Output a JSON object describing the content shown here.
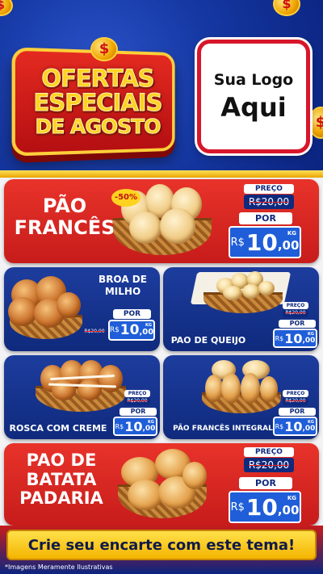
{
  "header": {
    "title_lines": [
      "OFERTAS",
      "ESPECIAIS",
      "DE AGOSTO"
    ],
    "coin_symbol": "$",
    "logo_line1": "Sua Logo",
    "logo_line2": "Aqui"
  },
  "labels": {
    "preco": "PREÇO",
    "por": "POR",
    "currency": "R$",
    "unit": "KG"
  },
  "products": {
    "pao_frances": {
      "name_line1": "PÃO",
      "name_line2": "FRANCÊS",
      "discount": "-50%",
      "old_price": "R$20,00",
      "price_int": "10",
      "price_dec": ",00"
    },
    "broa": {
      "name_line1": "BROA DE",
      "name_line2": "MILHO",
      "old_price": "R$20,00",
      "price_int": "10",
      "price_dec": ",00"
    },
    "pao_queijo": {
      "name": "PAO DE QUEIJO",
      "old_price": "R$20,00",
      "price_int": "10",
      "price_dec": ",00"
    },
    "rosca": {
      "name": "ROSCA COM CREME",
      "old_price": "R$20,00",
      "price_int": "10",
      "price_dec": ",00"
    },
    "integral": {
      "name": "PÃO FRANCÊS INTEGRAL",
      "old_price": "R$20,00",
      "price_int": "10",
      "price_dec": ",00"
    },
    "batata": {
      "name_line1": "PAO DE",
      "name_line2": "BATATA",
      "name_line3": "PADARIA",
      "old_price": "R$20,00",
      "price_int": "10",
      "price_dec": ",00"
    }
  },
  "footer": {
    "cta": "Crie seu encarte com este tema!",
    "disclaimer": "*Imagens Meramente Ilustrativas"
  },
  "colors": {
    "header_blue": "#1538a3",
    "card_red": "#d8262b",
    "card_blue": "#0f2a7d",
    "price_blue": "#1f5ed8",
    "gold": "#ffd21f"
  }
}
